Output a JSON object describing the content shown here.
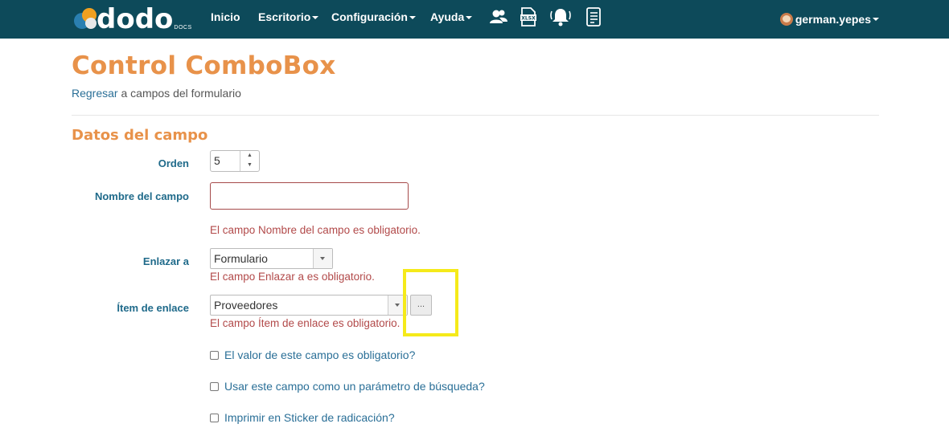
{
  "navbar": {
    "logo_text": "dodo",
    "logo_sub": "DOCS",
    "items": [
      {
        "label": "Inicio"
      },
      {
        "label": "Escritorio"
      },
      {
        "label": "Configuración"
      },
      {
        "label": "Ayuda"
      }
    ],
    "icons": [
      "users-icon",
      "xlsx-file-icon",
      "bell-icon",
      "document-list-icon"
    ],
    "user": "german.yepes",
    "background": "#0d4a5a"
  },
  "page": {
    "title": "Control ComboBox",
    "back_link": "Regresar",
    "back_rest": " a campos del formulario",
    "section_title": "Datos del campo"
  },
  "form": {
    "orden_label": "Orden",
    "orden_value": "5",
    "nombre_label": "Nombre del campo",
    "nombre_value": "",
    "nombre_error": "El campo Nombre del campo es obligatorio.",
    "enlazar_label": "Enlazar a",
    "enlazar_value": "Formulario",
    "enlazar_error": "El campo Enlazar a es obligatorio.",
    "item_label": "Ítem de enlace",
    "item_value": "Proveedores",
    "item_error": "El campo Ítem de enlace es obligatorio.",
    "dots_label": "...",
    "checkboxes": [
      {
        "label": "El valor de este campo es obligatorio?",
        "checked": false
      },
      {
        "label": "Usar este campo como un parámetro de búsqueda?",
        "checked": false
      },
      {
        "label": "Imprimir en Sticker de radicación?",
        "checked": false
      }
    ]
  },
  "colors": {
    "accent": "#e8924a",
    "label": "#1f6a8a",
    "error": "#b24a4a",
    "highlight": "#f5ea1a"
  }
}
